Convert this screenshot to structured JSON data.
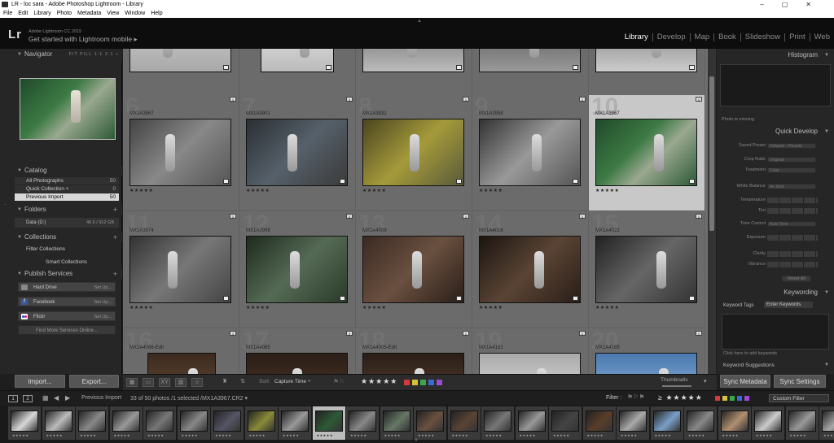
{
  "window": {
    "title": "LR - loc sara - Adobe Photoshop Lightroom - Library"
  },
  "menu": [
    "File",
    "Edit",
    "Library",
    "Photo",
    "Metadata",
    "View",
    "Window",
    "Help"
  ],
  "identity": {
    "logo": "Lr",
    "version": "Adobe Lightroom CC 2015",
    "mobile": "Get started with Lightroom mobile ▸"
  },
  "modules": [
    {
      "label": "Library",
      "active": true
    },
    {
      "label": "Develop",
      "active": false
    },
    {
      "label": "Map",
      "active": false
    },
    {
      "label": "Book",
      "active": false
    },
    {
      "label": "Slideshow",
      "active": false
    },
    {
      "label": "Print",
      "active": false
    },
    {
      "label": "Web",
      "active": false
    }
  ],
  "left": {
    "navigator": {
      "title": "Navigator",
      "options": "FIT  FILL  1:1  2:1 ÷"
    },
    "catalog": {
      "title": "Catalog",
      "items": [
        {
          "label": "All Photographs",
          "count": "50"
        },
        {
          "label": "Quick Collection +",
          "count": "0"
        },
        {
          "label": "Previous Import",
          "count": "50"
        }
      ]
    },
    "folders": {
      "title": "Folders",
      "row": "Data (D:)",
      "size": "46.6 / 912 GB"
    },
    "collections": {
      "title": "Collections",
      "items": [
        "Filter Collections",
        "Smart Collections"
      ]
    },
    "publish": {
      "title": "Publish Services",
      "items": [
        {
          "label": "Hard Drive",
          "setup": "Set Up..."
        },
        {
          "label": "Facebook",
          "setup": "Set Up..."
        },
        {
          "label": "Flickr",
          "setup": "Set Up..."
        }
      ],
      "find_more": "Find More Services Online..."
    },
    "import_label": "Import...",
    "export_label": "Export..."
  },
  "grid": {
    "rows": [
      [
        {
          "num": "",
          "file": "",
          "stars": "★★★★★"
        },
        {
          "num": "",
          "file": "",
          "stars": ""
        },
        {
          "num": "",
          "file": "",
          "stars": "★★★★★"
        },
        {
          "num": "",
          "file": "",
          "stars": "★★★★★"
        },
        {
          "num": "",
          "file": "",
          "stars": "★★★★★"
        }
      ],
      [
        {
          "num": "6",
          "file": "MX1A3867",
          "stars": "★★★★★"
        },
        {
          "num": "7",
          "file": "MX1A3901",
          "stars": "★★★★★"
        },
        {
          "num": "8",
          "file": "MX1A3932",
          "stars": "★★★★★"
        },
        {
          "num": "9",
          "file": "MX1A3958",
          "stars": "★★★★★"
        },
        {
          "num": "10",
          "file": "MX1A3967",
          "stars": "★★★★★"
        }
      ],
      [
        {
          "num": "11",
          "file": "MX1A3974",
          "stars": "★★★★★"
        },
        {
          "num": "12",
          "file": "MX1A3988",
          "stars": "★★★★★"
        },
        {
          "num": "13",
          "file": "MX1A4009",
          "stars": "★★★★★"
        },
        {
          "num": "14",
          "file": "MX1A4016",
          "stars": "★★★★★"
        },
        {
          "num": "15",
          "file": "MX1A4021",
          "stars": "★★★★★"
        }
      ],
      [
        {
          "num": "16",
          "file": "MX1A4066-Edit",
          "stars": ""
        },
        {
          "num": "17",
          "file": "MX1A4085",
          "stars": ""
        },
        {
          "num": "18",
          "file": "MX1A4005-Edit",
          "stars": ""
        },
        {
          "num": "19",
          "file": "MX1A4161",
          "stars": ""
        },
        {
          "num": "20",
          "file": "MX1A4165",
          "stars": ""
        }
      ]
    ]
  },
  "right": {
    "histogram": "Histogram",
    "photo_missing": "Photo is missing",
    "quick_develop": "Quick Develop",
    "qd_rows": [
      {
        "label": "Saved Preset",
        "value": "Defaults - Presets"
      },
      {
        "label": "Crop Ratio",
        "value": "Original"
      },
      {
        "label": "Treatment",
        "value": "Color"
      },
      {
        "label": "White Balance",
        "value": "As Shot"
      },
      {
        "label": "Temperature",
        "value": ""
      },
      {
        "label": "Tint",
        "value": ""
      },
      {
        "label": "Tone Control",
        "value": "Auto Tone"
      },
      {
        "label": "Exposure",
        "value": ""
      },
      {
        "label": "Clarity",
        "value": ""
      },
      {
        "label": "Vibrance",
        "value": ""
      }
    ],
    "reset_all": "Reset All",
    "keywording": "Keywording",
    "keyword_tags": "Keyword Tags",
    "enter_keywords": "Enter Keywords",
    "kw_hint": "Click here to add keywords",
    "kw_suggestions": "Keyword Suggestions",
    "sync_metadata": "Sync Metadata",
    "sync_settings": "Sync Settings"
  },
  "toolbar": {
    "sort_label": "Sort:",
    "sort_value": "Capture Time ÷",
    "stars": "★★★★★",
    "thumbnails": "Thumbnails"
  },
  "filmbar": {
    "pages": [
      "1",
      "2"
    ],
    "source": "Previous Import",
    "status": "33 of 50 photos /1 selected /MX1A3967.CR2 ▾",
    "filter": "Filter :",
    "filter_stars": "≥ ★★★★★",
    "custom_filter": "Custom Filter"
  },
  "colors": {
    "accent": "#ffffff",
    "grid_bg": "#707070",
    "selected_cell": "#c8c8c8",
    "label_red": "#d43a3a",
    "label_yellow": "#d4c23a",
    "label_green": "#3aa84a",
    "label_blue": "#3a6ad4",
    "label_purple": "#9a4ad4"
  },
  "filmstrip": {
    "count": 25,
    "selected_index": 9,
    "stars": "★★★★★"
  }
}
